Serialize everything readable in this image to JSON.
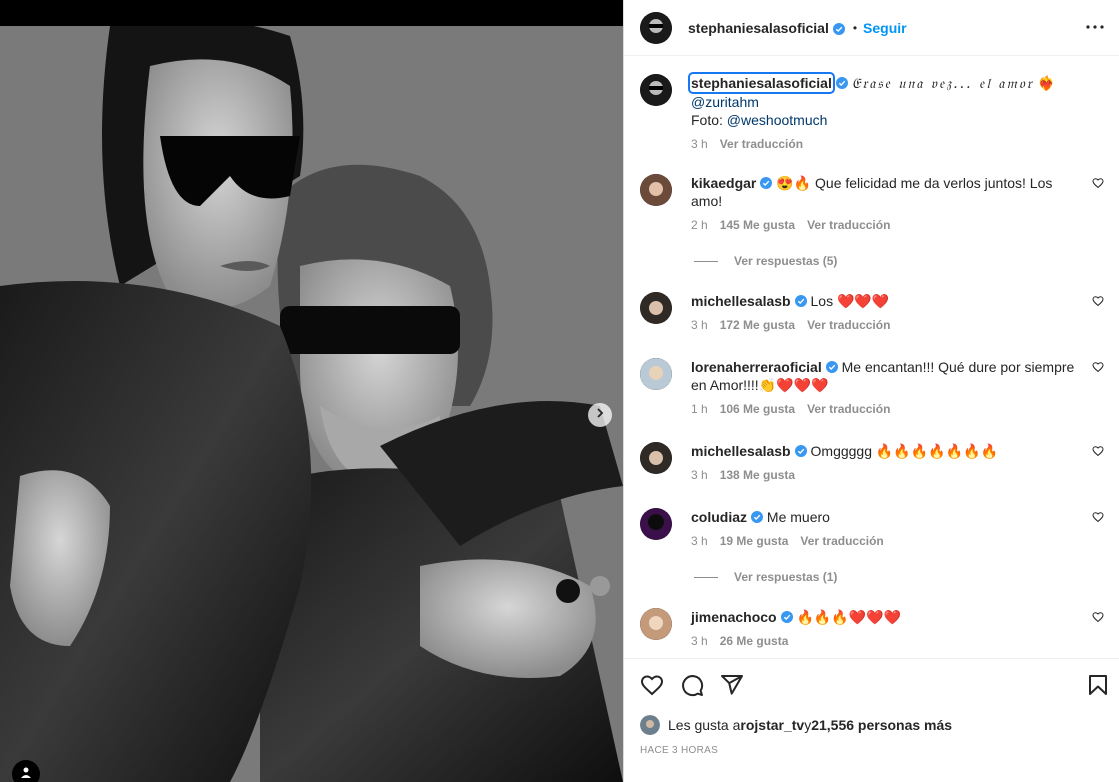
{
  "post": {
    "username": "stephaniesalasoficial",
    "follow_label": "Seguir",
    "dot": "•",
    "caption_text": "𝔈𝔯𝔞𝔰𝔢 𝔲𝔫𝔞 𝔳𝔢𝔷... 𝔢𝔩 𝔞𝔪𝔬𝔯",
    "caption_mention": "@zuritahm",
    "photo_prefix": "Foto: ",
    "photo_mention": "@weshootmuch",
    "caption_time": "3 h",
    "translate_label": "Ver traducción"
  },
  "comments": [
    {
      "user": "kikaedgar",
      "text": "😍🔥 Que felicidad me da verlos juntos! Los amo!",
      "time": "2 h",
      "likes": "145 Me gusta",
      "translate": "Ver traducción",
      "replies": "Ver respuestas (5)"
    },
    {
      "user": "michellesalasb",
      "text": "Los ❤️❤️❤️",
      "time": "3 h",
      "likes": "172 Me gusta",
      "translate": "Ver traducción"
    },
    {
      "user": "lorenaherreraoficial",
      "text": "Me encantan!!! Qué dure por siempre en Amor!!!!👏❤️❤️❤️",
      "time": "1 h",
      "likes": "106 Me gusta",
      "translate": "Ver traducción"
    },
    {
      "user": "michellesalasb",
      "text": "Omggggg 🔥🔥🔥🔥🔥🔥🔥",
      "time": "3 h",
      "likes": "138 Me gusta"
    },
    {
      "user": "coludiaz",
      "text": "Me muero",
      "time": "3 h",
      "likes": "19 Me gusta",
      "translate": "Ver traducción",
      "replies": "Ver respuestas (1)"
    },
    {
      "user": "jimenachoco",
      "text": "🔥🔥🔥❤️❤️❤️",
      "time": "3 h",
      "likes": "26 Me gusta"
    }
  ],
  "footer": {
    "likes_prefix": "Les gusta a ",
    "liker": "rojstar_tv",
    "likes_mid": " y ",
    "likes_count": "21,556 personas más",
    "time_ago": "HACE 3 HORAS"
  },
  "colors": {
    "accent": "#0095f6",
    "verified": "#3897f0",
    "muted": "#8e8e8e",
    "text": "#262626"
  },
  "icons": [
    "more-icon",
    "heart-icon",
    "comment-icon",
    "share-icon",
    "bookmark-icon",
    "chevron-right-icon",
    "verified-icon",
    "user-tag-icon"
  ]
}
